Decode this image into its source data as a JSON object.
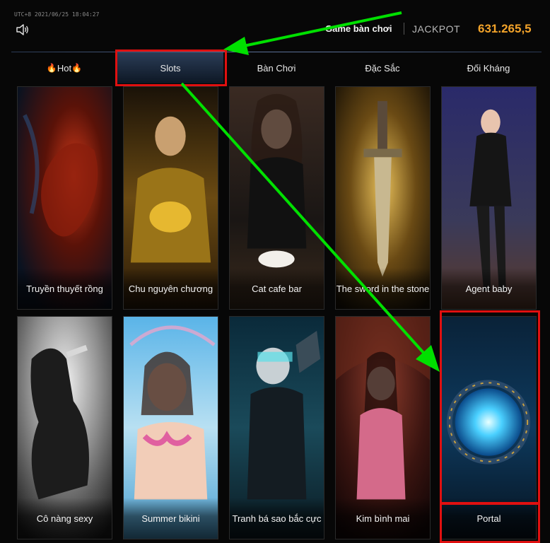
{
  "header": {
    "timestamp": "UTC+8 2021/06/25 18:04:27",
    "title": "Game bàn chơi",
    "jackpot_label": "JACKPOT",
    "jackpot_value": "631.265,5",
    "speaker_icon": "speaker-icon",
    "accent_color": "#f2a32a"
  },
  "tabs": [
    {
      "label": "Hot",
      "active": false,
      "icon": "flame-icon"
    },
    {
      "label": "Slots",
      "active": true
    },
    {
      "label": "Bàn Chơi",
      "active": false
    },
    {
      "label": "Đặc Sắc",
      "active": false
    },
    {
      "label": "Đối Kháng",
      "active": false
    }
  ],
  "games": [
    {
      "title": "Truyền thuyết rồng"
    },
    {
      "title": "Chu nguyên chương"
    },
    {
      "title": "Cat cafe bar"
    },
    {
      "title": "The sword in the stone"
    },
    {
      "title": "Agent baby"
    },
    {
      "title": "Cô nàng sexy"
    },
    {
      "title": "Summer bikini"
    },
    {
      "title": "Tranh bá sao bắc cực"
    },
    {
      "title": "Kim bình mai"
    },
    {
      "title": "Portal"
    }
  ],
  "annotations": {
    "highlight_color": "#e01010",
    "arrow_color": "#00e000"
  }
}
